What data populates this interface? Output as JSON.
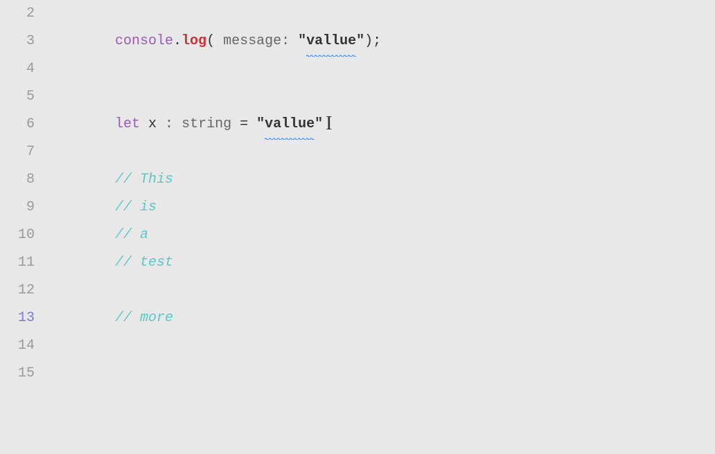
{
  "editor": {
    "background": "#e8e8e8",
    "lines": [
      {
        "number": "2",
        "content": "",
        "type": "empty",
        "active": false
      },
      {
        "number": "3",
        "content": "console.log( message: \"vallue\" );",
        "type": "code",
        "active": false
      },
      {
        "number": "4",
        "content": "",
        "type": "empty",
        "active": false
      },
      {
        "number": "5",
        "content": "",
        "type": "empty",
        "active": false
      },
      {
        "number": "6",
        "content": "let x : string = \"vallue\"",
        "type": "code",
        "active": false
      },
      {
        "number": "7",
        "content": "",
        "type": "empty",
        "active": false
      },
      {
        "number": "8",
        "content": "// This",
        "type": "comment",
        "active": false
      },
      {
        "number": "9",
        "content": "// is",
        "type": "comment",
        "active": false
      },
      {
        "number": "10",
        "content": "// a",
        "type": "comment",
        "active": false
      },
      {
        "number": "11",
        "content": "// test",
        "type": "comment",
        "active": false
      },
      {
        "number": "12",
        "content": "",
        "type": "empty",
        "active": false
      },
      {
        "number": "13",
        "content": "// more",
        "type": "comment",
        "active": true
      },
      {
        "number": "14",
        "content": "",
        "type": "empty",
        "active": false
      },
      {
        "number": "15",
        "content": "",
        "type": "empty",
        "active": false
      }
    ]
  }
}
